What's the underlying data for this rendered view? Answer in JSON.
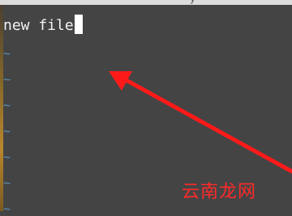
{
  "editor": {
    "line1_text": "new file",
    "tilde": "~",
    "tilde_count": 7
  },
  "overlay": {
    "watermark": "云南龙网",
    "arrow_color": "#ff1a1a"
  },
  "colors": {
    "background": "#444444",
    "tilde": "#5b8fb5",
    "text": "#f2f2f2"
  },
  "topbar": {
    "partial_glyph": "y"
  }
}
